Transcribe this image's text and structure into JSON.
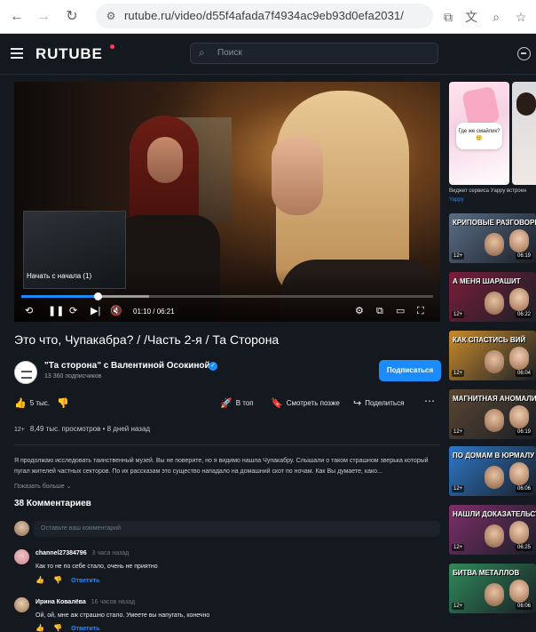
{
  "browser": {
    "url": "rutube.ru/video/d55f4afada7f4934ac9eb93d0efa2031/"
  },
  "header": {
    "logo": "RUTUBE",
    "search_placeholder": "Поиск"
  },
  "player": {
    "preview_label": "Начать с начала (1)",
    "time": "01:10 / 06:21",
    "progress": 0.185,
    "buffered": 0.31
  },
  "video": {
    "title": "Это что, Чупакабра? / /Часть 2-я / Та Сторона",
    "channel_name": "\"Та сторона\" с Валентиной Осокиной",
    "subscribers": "13 360 подписчиков",
    "subscribe_label": "Подписаться",
    "likes": "5 тыс.",
    "top_label": "В топ",
    "watch_later_label": "Смотреть позже",
    "share_label": "Поделиться",
    "age_badge": "12+",
    "views": "8,49 тыс. просмотров",
    "posted": "8 дней назад",
    "description": "Я продолжаю исследовать таинственный музей. Вы не поверите, но я видимо нашла Чупакабру. Слышали о таком страшном зверька который пугал жителей частных секторов. По их рассказам это существо нападало на домашний скот по ночам. Как Вы думаете, како...",
    "show_more": "Показать больше"
  },
  "comments": {
    "title": "38 Комментариев",
    "input_placeholder": "Оставьте ваш комментарий",
    "reply_label": "Ответить",
    "items": [
      {
        "author": "channel27384796",
        "time": "3 часа назад",
        "text": "Как то не по себе стало, очень не приятно"
      },
      {
        "author": "Ирина Ковалёва",
        "time": "16 часов назад",
        "text": "Ой, ой, мне аж страшно стало. Умеете вы напугать, конечно"
      }
    ]
  },
  "sidebar": {
    "promo_bubble": "Где же смайлик? 🙂",
    "promo_caption": "Виджет сервиса Уарру встроен",
    "promo_sub": "Yappy",
    "videos": [
      {
        "label": "Криповые разговоры",
        "age": "12+",
        "duration": "06:19",
        "color": "#5b6e86"
      },
      {
        "label": "А меня шарашит",
        "age": "12+",
        "duration": "06:22",
        "color": "#7a1e3a"
      },
      {
        "label": "Как спастись ВИЙ",
        "age": "12+",
        "duration": "06:04",
        "color": "#c88a2c"
      },
      {
        "label": "Магнитная аномалия",
        "age": "12+",
        "duration": "06:19",
        "color": "#5a4632"
      },
      {
        "label": "По домам в Юрмалу",
        "age": "12+",
        "duration": "06:06",
        "color": "#2f78c8"
      },
      {
        "label": "Нашли доказательства",
        "age": "12+",
        "duration": "06:25",
        "color": "#7e2f6a"
      },
      {
        "label": "Битва металлов",
        "age": "12+",
        "duration": "06:06",
        "color": "#2f8a5a"
      }
    ]
  }
}
